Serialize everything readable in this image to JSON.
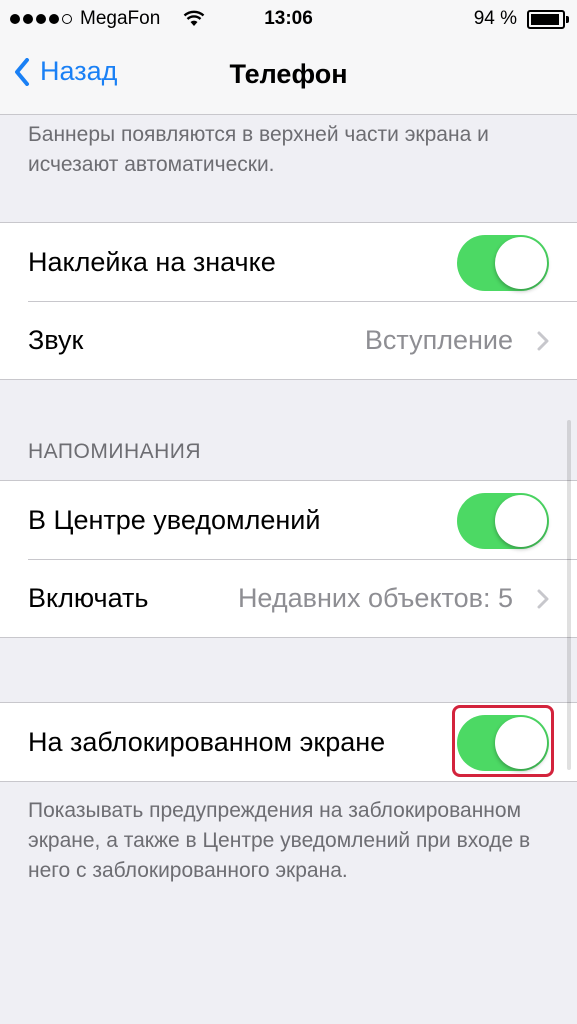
{
  "status_bar": {
    "carrier": "MegaFon",
    "time": "13:06",
    "battery": "94 %"
  },
  "nav": {
    "back_label": "Назад",
    "title": "Телефон"
  },
  "banner_note": "Баннеры появляются в верхней части экрана и исчезают автоматически.",
  "group1": {
    "badge_label": "Наклейка на значке",
    "badge_on": true,
    "sound_label": "Звук",
    "sound_value": "Вступление"
  },
  "reminders": {
    "header": "НАПОМИНАНИЯ",
    "center_label": "В Центре уведомлений",
    "center_on": true,
    "include_label": "Включать",
    "include_value": "Недавних объектов: 5"
  },
  "lockscreen": {
    "label": "На заблокированном экране",
    "on": true,
    "note": "Показывать предупреждения на заблокированном экране, а также в Центре уведомлений при входе в него с заблокированного экрана."
  },
  "colors": {
    "accent": "#1a80f5",
    "switch_on": "#4cd964",
    "highlight": "#d3233c"
  }
}
